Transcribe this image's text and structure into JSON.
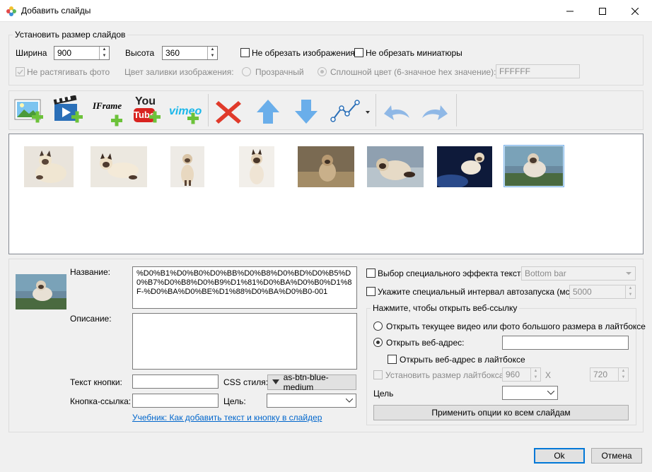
{
  "window": {
    "title": "Добавить слайды",
    "controls": [
      "minimize-icon",
      "maximize-icon",
      "close-icon"
    ]
  },
  "slide_size": {
    "group_label": "Установить размер слайдов",
    "width_label": "Ширина",
    "width_value": "900",
    "height_label": "Высота",
    "height_value": "360",
    "no_crop_images": "Не обрезать изображения",
    "no_crop_thumbs": "Не обрезать миниатюры",
    "no_stretch": "Не растягивать фото",
    "fill_color_label": "Цвет заливки изображения:",
    "transparent": "Прозрачный",
    "solid_color": "Сплошной цвет (6-значное hex значение):",
    "hex_value": "FFFFFF"
  },
  "toolbar": {
    "iframe_label": "IFrame",
    "youtube_label_1": "You",
    "youtube_label_2": "Tube",
    "vimeo_label": "vimeo",
    "icons": [
      "add-image-icon",
      "add-video-icon",
      "add-iframe-icon",
      "add-youtube-icon",
      "add-vimeo-icon",
      "delete-icon",
      "move-up-icon",
      "move-down-icon",
      "motion-path-icon",
      "undo-icon",
      "redo-icon"
    ]
  },
  "thumbnails": {
    "count": 8,
    "selected_index": 7
  },
  "slide_details": {
    "name_label": "Название:",
    "name_value": "%D0%B1%D0%B0%D0%BB%D0%B8%D0%BD%D0%B5%D0%B7%D0%B8%D0%B9%D1%81%D0%BA%D0%B0%D1%8F-%D0%BA%D0%BE%D1%88%D0%BA%D0%B0-001",
    "desc_label": "Описание:",
    "desc_value": "",
    "button_text_label": "Текст кнопки:",
    "button_text_value": "",
    "css_style_label": "CSS стиля:",
    "css_style_value": "as-btn-blue-medium",
    "button_link_label": "Кнопка-ссылка:",
    "button_link_value": "",
    "target_label": "Цель:",
    "target_value": "",
    "tutorial_link": "Учебник: Как добавить текст и кнопку в слайдер"
  },
  "effects": {
    "special_text_effect": "Выбор специального эффекта текста",
    "effect_value": "Bottom bar",
    "autoplay_interval": "Укажите специальный интервал автозапуска (мс):",
    "interval_value": "5000"
  },
  "weblink": {
    "group_label": "Нажмите, чтобы открыть веб-ссылку",
    "open_lightbox": "Открыть текущее видео или фото большого размера в лайтбоксе",
    "open_url": "Открыть веб-адрес:",
    "url_value": "",
    "open_url_lightbox": "Открыть веб-адрес в лайтбоксе",
    "set_lightbox_size": "Установить размер лайтбокса",
    "lb_width": "960",
    "x_sep": "X",
    "lb_height": "720",
    "target_label": "Цель",
    "target_value": "",
    "apply_all": "Применить опции ко всем слайдам"
  },
  "footer": {
    "ok": "Ok",
    "cancel": "Отмена"
  },
  "colors": {
    "accent": "#0078d7",
    "delete_red": "#e03a2a",
    "arrow_blue": "#4a8fdc",
    "link": "#0066cc"
  }
}
